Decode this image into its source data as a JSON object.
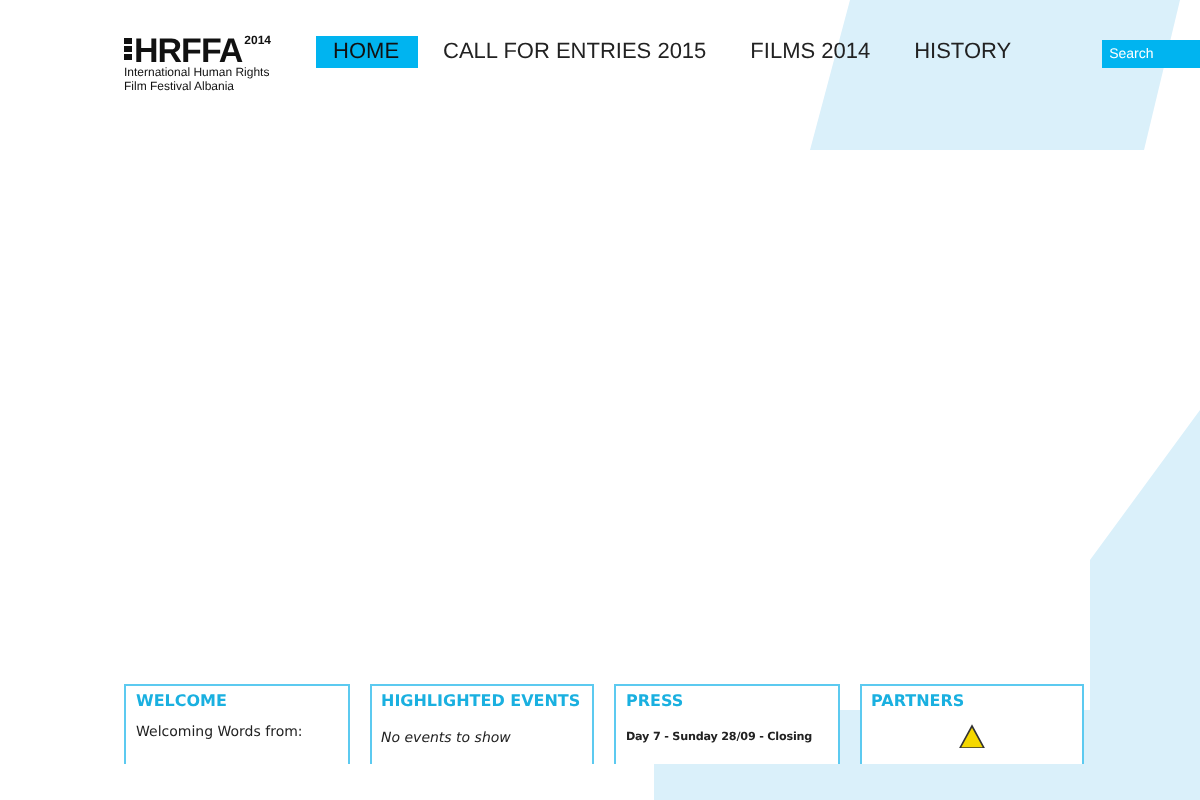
{
  "logo": {
    "name": "HRFFA",
    "year": "2014",
    "tagline": [
      "International Human Rights",
      "Film Festival Albania"
    ]
  },
  "nav": [
    {
      "label": "HOME",
      "selected": true
    },
    {
      "label": "CALL FOR ENTRIES 2015",
      "selected": false
    },
    {
      "label": "FILMS 2014",
      "selected": false
    },
    {
      "label": "HISTORY",
      "selected": false
    }
  ],
  "search": {
    "placeholder": "Search"
  },
  "panels": [
    {
      "kind": "text",
      "title": "WELCOME",
      "text": "Welcoming Words from:"
    },
    {
      "kind": "empty",
      "title": "HIGHLIGHTED EVENTS",
      "text": "No events to show"
    },
    {
      "kind": "bold",
      "title": "PRESS",
      "text": "Day 7 - Sunday 28/09 - Closing"
    },
    {
      "kind": "icon",
      "title": "PARTNERS"
    }
  ]
}
